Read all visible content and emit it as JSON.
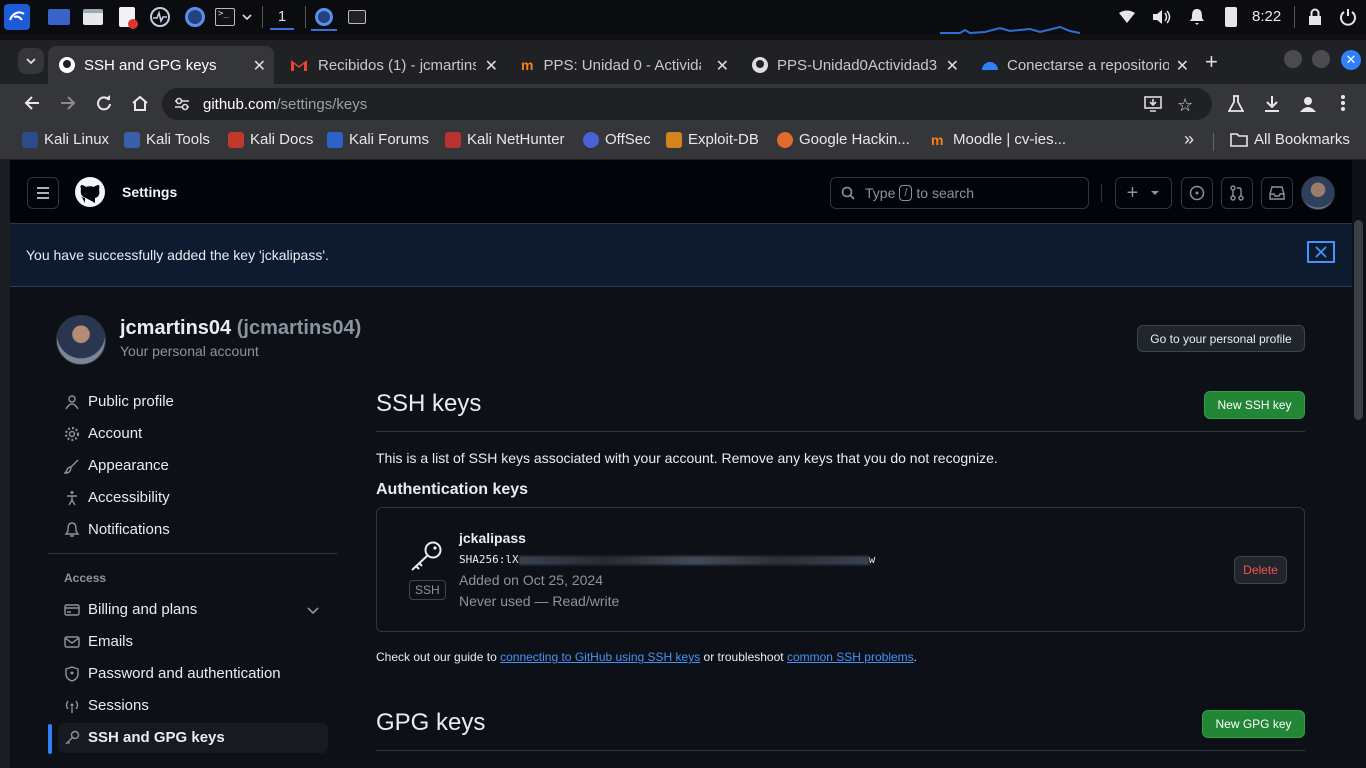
{
  "taskbar": {
    "workspace": "1",
    "time": "8:22"
  },
  "tabs": [
    {
      "title": "SSH and GPG keys",
      "active": true
    },
    {
      "title": "Recibidos (1) - jcmartins",
      "active": false
    },
    {
      "title": "PPS: Unidad 0 - Actividad",
      "active": false
    },
    {
      "title": "PPS-Unidad0Actividad3",
      "active": false
    },
    {
      "title": "Conectarse a repositorio",
      "active": false
    }
  ],
  "address": {
    "host": "github.com",
    "path": "/settings/keys"
  },
  "bookmarks": [
    "Kali Linux",
    "Kali Tools",
    "Kali Docs",
    "Kali Forums",
    "Kali NetHunter",
    "OffSec",
    "Exploit-DB",
    "Google Hackin...",
    "Moodle | cv-ies..."
  ],
  "bookmarks_more": "»",
  "all_bookmarks": "All Bookmarks",
  "header": {
    "title": "Settings",
    "search_type": "Type",
    "search_key": "/",
    "search_rest": "to search"
  },
  "flash": {
    "message": "You have successfully added the key 'jckalipass'."
  },
  "user": {
    "name": "jcmartins04",
    "handle": "(jcmartins04)",
    "subtitle": "Your personal account",
    "profile_button": "Go to your personal profile"
  },
  "nav": {
    "items": [
      {
        "label": "Public profile",
        "icon": "person-icon"
      },
      {
        "label": "Account",
        "icon": "gear-icon"
      },
      {
        "label": "Appearance",
        "icon": "paintbrush-icon"
      },
      {
        "label": "Accessibility",
        "icon": "accessibility-icon"
      },
      {
        "label": "Notifications",
        "icon": "bell-icon"
      }
    ],
    "section_access": "Access",
    "access_items": [
      {
        "label": "Billing and plans",
        "icon": "credit-card-icon"
      },
      {
        "label": "Emails",
        "icon": "mail-icon"
      },
      {
        "label": "Password and authentication",
        "icon": "shield-icon"
      },
      {
        "label": "Sessions",
        "icon": "broadcast-icon"
      },
      {
        "label": "SSH and GPG keys",
        "icon": "key-icon",
        "selected": true
      }
    ]
  },
  "ssh": {
    "title": "SSH keys",
    "new_button": "New SSH key",
    "description": "This is a list of SSH keys associated with your account. Remove any keys that you do not recognize.",
    "auth_heading": "Authentication keys",
    "key": {
      "name": "jckalipass",
      "fingerprint_prefix": "SHA256:lX",
      "fingerprint_suffix": "w",
      "added": "Added on Oct 25, 2024",
      "usage": "Never used — Read/write",
      "badge": "SSH",
      "delete": "Delete"
    },
    "guide_prefix": "Check out our guide to",
    "guide_link1": "connecting to GitHub using SSH keys",
    "guide_middle": "or troubleshoot",
    "guide_link2": "common SSH problems",
    "guide_end": "."
  },
  "gpg": {
    "title": "GPG keys",
    "new_button": "New GPG key"
  },
  "colors": {
    "accent": "#4493f8",
    "green": "#238636",
    "danger": "#f85149",
    "bg": "#0d1117"
  }
}
